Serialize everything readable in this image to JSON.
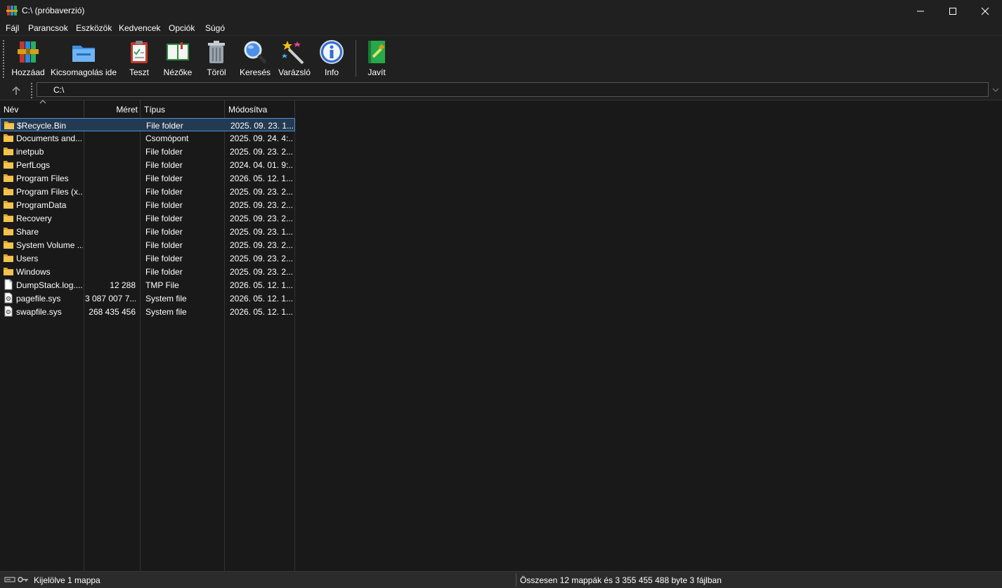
{
  "window": {
    "title": "C:\\ (próbaverzió)",
    "minimize_glyph": "—",
    "maximize_glyph": "☐",
    "close_glyph": "✕"
  },
  "menu": [
    "Fájl",
    "Parancsok",
    "Eszközök",
    "Kedvencek",
    "Opciók",
    "Súgó"
  ],
  "toolbar": [
    {
      "label": "Hozzáad",
      "icon": "rar-archive-books-icon"
    },
    {
      "label": "Kicsomagolás ide",
      "icon": "folder-extract-icon"
    },
    {
      "label": "Teszt",
      "icon": "clipboard-check-icon"
    },
    {
      "label": "Nézőke",
      "icon": "open-book-icon"
    },
    {
      "label": "Töröl",
      "icon": "trash-can-icon"
    },
    {
      "label": "Keresés",
      "icon": "magnifier-icon"
    },
    {
      "label": "Varázsló",
      "icon": "magic-wand-icon"
    },
    {
      "label": "Info",
      "icon": "info-icon"
    },
    {
      "label": "Javít",
      "icon": "repair-book-icon"
    }
  ],
  "address": {
    "path": "C:\\"
  },
  "columns": {
    "name": "Név",
    "size": "Méret",
    "type": "Típus",
    "modified": "Módosítva"
  },
  "files": [
    {
      "name": "$Recycle.Bin",
      "size": "",
      "type": "File folder",
      "modified": "2025. 09. 23. 1...",
      "kind": "folder",
      "selected": true
    },
    {
      "name": "Documents and...",
      "size": "",
      "type": "Csomópont",
      "modified": "2025. 09. 24. 4:...",
      "kind": "folder"
    },
    {
      "name": "inetpub",
      "size": "",
      "type": "File folder",
      "modified": "2025. 09. 23. 2...",
      "kind": "folder"
    },
    {
      "name": "PerfLogs",
      "size": "",
      "type": "File folder",
      "modified": "2024. 04. 01. 9:...",
      "kind": "folder"
    },
    {
      "name": "Program Files",
      "size": "",
      "type": "File folder",
      "modified": "2026. 05. 12. 1...",
      "kind": "folder"
    },
    {
      "name": "Program Files (x...",
      "size": "",
      "type": "File folder",
      "modified": "2025. 09. 23. 2...",
      "kind": "folder"
    },
    {
      "name": "ProgramData",
      "size": "",
      "type": "File folder",
      "modified": "2025. 09. 23. 2...",
      "kind": "folder"
    },
    {
      "name": "Recovery",
      "size": "",
      "type": "File folder",
      "modified": "2025. 09. 23. 2...",
      "kind": "folder"
    },
    {
      "name": "Share",
      "size": "",
      "type": "File folder",
      "modified": "2025. 09. 23. 1...",
      "kind": "folder"
    },
    {
      "name": "System Volume ...",
      "size": "",
      "type": "File folder",
      "modified": "2025. 09. 23. 2...",
      "kind": "folder"
    },
    {
      "name": "Users",
      "size": "",
      "type": "File folder",
      "modified": "2025. 09. 23. 2...",
      "kind": "folder"
    },
    {
      "name": "Windows",
      "size": "",
      "type": "File folder",
      "modified": "2025. 09. 23. 2...",
      "kind": "folder"
    },
    {
      "name": "DumpStack.log....",
      "size": "12 288",
      "type": "TMP File",
      "modified": "2026. 05. 12. 1...",
      "kind": "file"
    },
    {
      "name": "pagefile.sys",
      "size": "3 087 007 7...",
      "type": "System file",
      "modified": "2026. 05. 12. 1...",
      "kind": "sysfile"
    },
    {
      "name": "swapfile.sys",
      "size": "268 435 456",
      "type": "System file",
      "modified": "2026. 05. 12. 1...",
      "kind": "sysfile"
    }
  ],
  "status": {
    "left": "Kijelölve 1 mappa",
    "right": "Összesen 12 mappák és 3 355 455 488 byte 3 fájlban"
  },
  "colors": {
    "background": "#202020",
    "list_background": "#191919",
    "selection": "#243a52",
    "selection_border": "#4b8fd6",
    "folder": "#f0c24a"
  }
}
